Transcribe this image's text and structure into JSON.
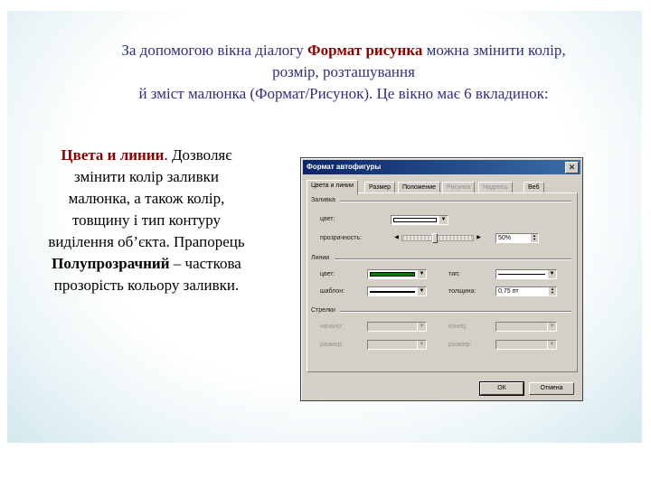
{
  "intro": {
    "line1_prefix": "За допомогою вікна діалогу ",
    "line1_bold": "Формат рисунка",
    "line1_suffix": " можна змінити колір,",
    "line2": "розмір, розташування",
    "line3": "й зміст малюнка (Формат/Рисунок). Це вікно має 6 вкладинок:"
  },
  "left": {
    "title": "Цвета и линии",
    "title_period": ".",
    "body": "Дозволяє змінити колір заливки малюнка, а також колір, товщину і тип контуру виділення об’єкта.",
    "flag_word": "Прапорець",
    "flag_name": "Полупрозрачний",
    "flag_desc": " – часткова прозорість кольору заливки."
  },
  "dialog": {
    "title": "Формат автофигуры",
    "close_glyph": "✕",
    "tabs": [
      {
        "label": "Цвета и линии",
        "state": "active"
      },
      {
        "label": "Размер",
        "state": "normal"
      },
      {
        "label": "Положение",
        "state": "normal"
      },
      {
        "label": "Рисунок",
        "state": "disabled"
      },
      {
        "label": "Надпись",
        "state": "disabled"
      },
      {
        "label": "Веб",
        "state": "normal"
      }
    ],
    "fill": {
      "group": "Заливка",
      "color_label": "цвет:",
      "transparency_label": "прозрачность:",
      "transparency_value": "50%",
      "color_value": "#ffffff"
    },
    "line": {
      "group": "Линии",
      "color_label": "цвет:",
      "color_value": "#008000",
      "style_label": "шаблон:",
      "type_label": "тип:",
      "weight_label": "толщина:",
      "weight_value": "0,75 пт"
    },
    "arrows": {
      "group": "Стрелки",
      "begin_label": "начало:",
      "end_label": "конец:",
      "begin_size_label": "размер:",
      "end_size_label": "размер:"
    },
    "ok_label": "ОК",
    "cancel_label": "Отмена",
    "arrow_glyph": "▼",
    "spin_glyph_up": "▲",
    "spin_glyph_down": "▼",
    "slider_left": "◀",
    "slider_right": "▶"
  },
  "colors": {
    "intro_text": "#2f2f80",
    "accent": "#8b0000",
    "titlebar": "#0a246a",
    "dialog_bg": "#d4d0c8"
  }
}
